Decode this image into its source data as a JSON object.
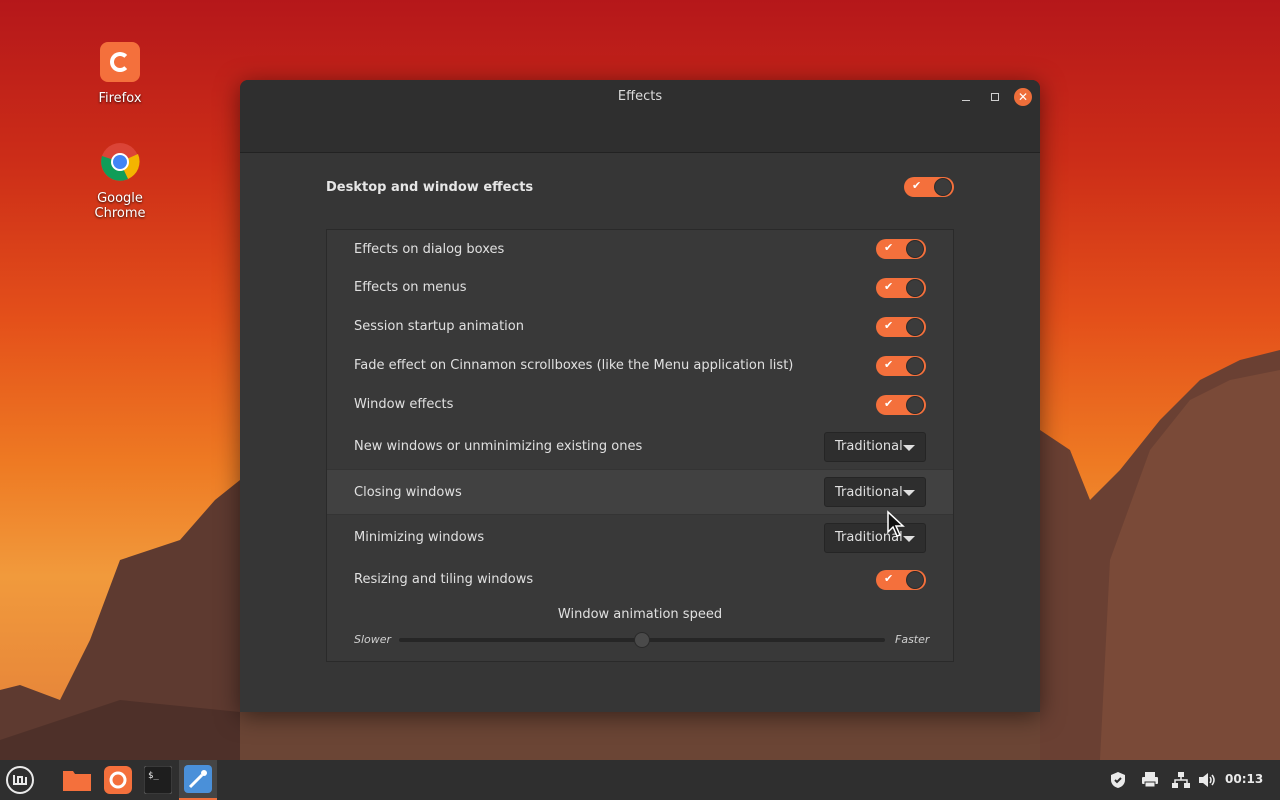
{
  "desktop": {
    "icons": [
      {
        "label": "Firefox"
      },
      {
        "label": "Google Chrome"
      }
    ]
  },
  "window": {
    "title": "Effects",
    "main_setting": {
      "label": "Desktop and window effects",
      "enabled": true
    },
    "rows": [
      {
        "label": "Effects on dialog boxes",
        "type": "toggle",
        "enabled": true
      },
      {
        "label": "Effects on menus",
        "type": "toggle",
        "enabled": true
      },
      {
        "label": "Session startup animation",
        "type": "toggle",
        "enabled": true
      },
      {
        "label": "Fade effect on Cinnamon scrollboxes (like the Menu application list)",
        "type": "toggle",
        "enabled": true
      },
      {
        "label": "Window effects",
        "type": "toggle",
        "enabled": true
      },
      {
        "label": "New windows or unminimizing existing ones",
        "type": "combo",
        "value": "Traditional"
      },
      {
        "label": "Closing windows",
        "type": "combo",
        "value": "Traditional"
      },
      {
        "label": "Minimizing windows",
        "type": "combo",
        "value": "Traditional"
      },
      {
        "label": "Resizing and tiling windows",
        "type": "toggle",
        "enabled": true
      }
    ],
    "speed": {
      "title": "Window animation speed",
      "min_label": "Slower",
      "max_label": "Faster",
      "value": 0.5
    }
  },
  "taskbar": {
    "clock": "00:13",
    "launchers": [
      "menu-icon",
      "files-icon",
      "firefox-icon",
      "terminal-icon",
      "settings-icon"
    ],
    "tray": [
      "shield-icon",
      "printer-icon",
      "network-icon",
      "volume-icon"
    ]
  },
  "colors": {
    "accent": "#f4703c"
  }
}
